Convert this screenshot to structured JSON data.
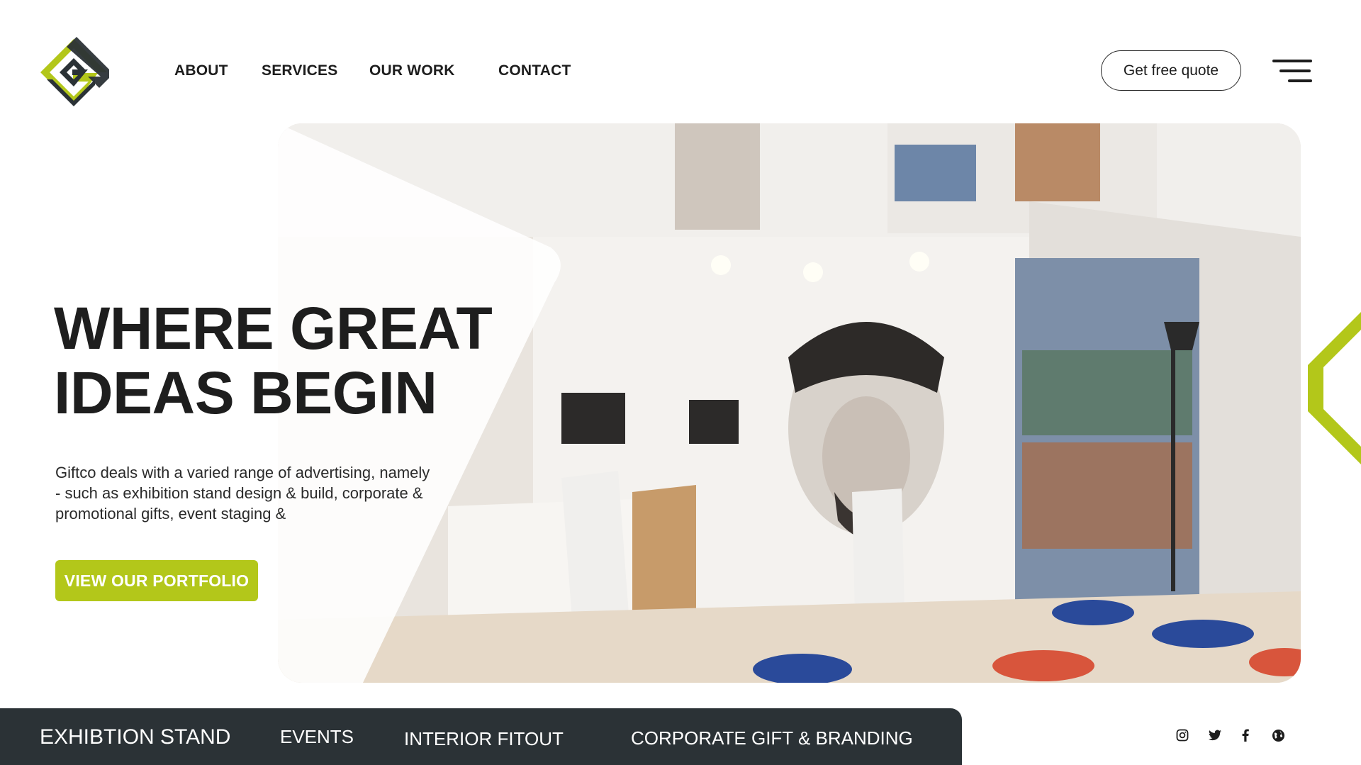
{
  "header": {
    "logo_icon": "giftco-logo-icon",
    "nav": [
      {
        "label": "ABOUT"
      },
      {
        "label": "SERVICES"
      },
      {
        "label": "OUR WORK"
      },
      {
        "label": "CONTACT"
      }
    ],
    "quote_button": "Get free quote",
    "menu_icon": "hamburger-menu-icon"
  },
  "hero": {
    "headline_line1": "WHERE GREAT",
    "headline_line2": "IDEAS BEGIN",
    "description": "Giftco deals with a varied range of advertising, namely - such as exhibition stand design & build, corporate & promotional gifts, event staging &",
    "portfolio_button": "VIEW OUR PORTFOLIO",
    "image_content": "exhibition-stand-photo"
  },
  "categories": [
    {
      "label": "EXHIBTION STAND"
    },
    {
      "label": "EVENTS"
    },
    {
      "label": "INTERIOR FITOUT"
    },
    {
      "label": "CORPORATE GIFT & BRANDING"
    }
  ],
  "social": [
    {
      "icon": "instagram-icon"
    },
    {
      "icon": "twitter-icon"
    },
    {
      "icon": "facebook-icon"
    },
    {
      "icon": "globe-icon"
    }
  ],
  "colors": {
    "brand_green": "#b3c71a",
    "brand_dark": "#2b3236",
    "text": "#1e1e1e"
  }
}
